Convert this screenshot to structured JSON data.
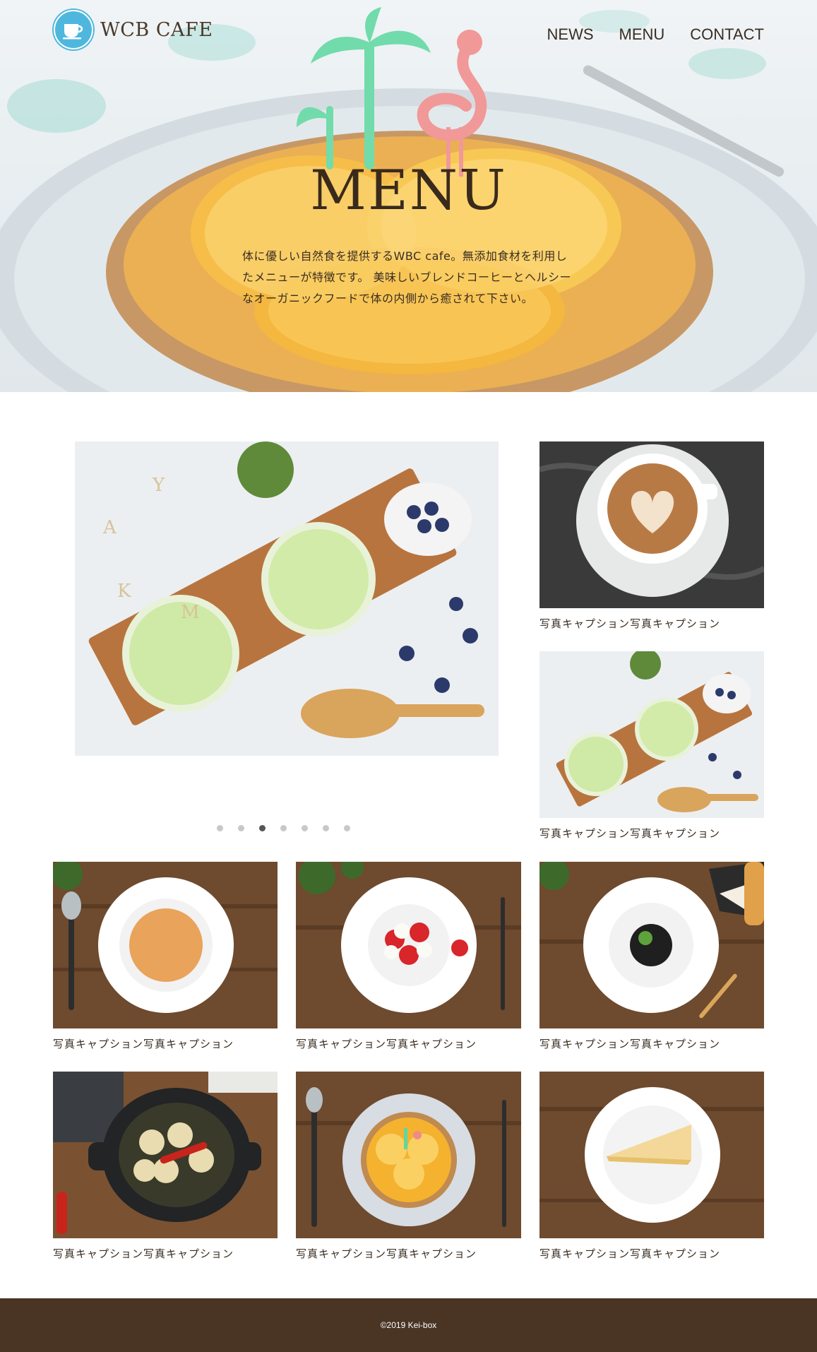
{
  "header": {
    "logo_text": "WCB CAFE",
    "logo_icon": "cafe-cup-icon",
    "nav": [
      {
        "label": "NEWS"
      },
      {
        "label": "MENU"
      },
      {
        "label": "CONTACT"
      }
    ]
  },
  "hero": {
    "title": "MENU",
    "description": "体に優しい自然食を提供するWBC cafe。無添加食材を利用したメニューが特徴です。 美味しいブレンドコーヒーとヘルシーなオーガニックフードで体の内側から癒されて下さい。"
  },
  "slider": {
    "dot_count": 7,
    "active_index": 2
  },
  "side_items": [
    {
      "caption": "写真キャプション写真キャプション"
    },
    {
      "caption": "写真キャプション写真キャプション"
    }
  ],
  "grid_items": [
    {
      "caption": "写真キャプション写真キャプション"
    },
    {
      "caption": "写真キャプション写真キャプション"
    },
    {
      "caption": "写真キャプション写真キャプション"
    },
    {
      "caption": "写真キャプション写真キャプション"
    },
    {
      "caption": "写真キャプション写真キャプション"
    },
    {
      "caption": "写真キャプション写真キャプション"
    }
  ],
  "footer": {
    "copyright": "©2019 Kei-box"
  },
  "colors": {
    "brand": "#4fb7dd",
    "text": "#3a2d22",
    "footer_bg": "#4a3424"
  }
}
